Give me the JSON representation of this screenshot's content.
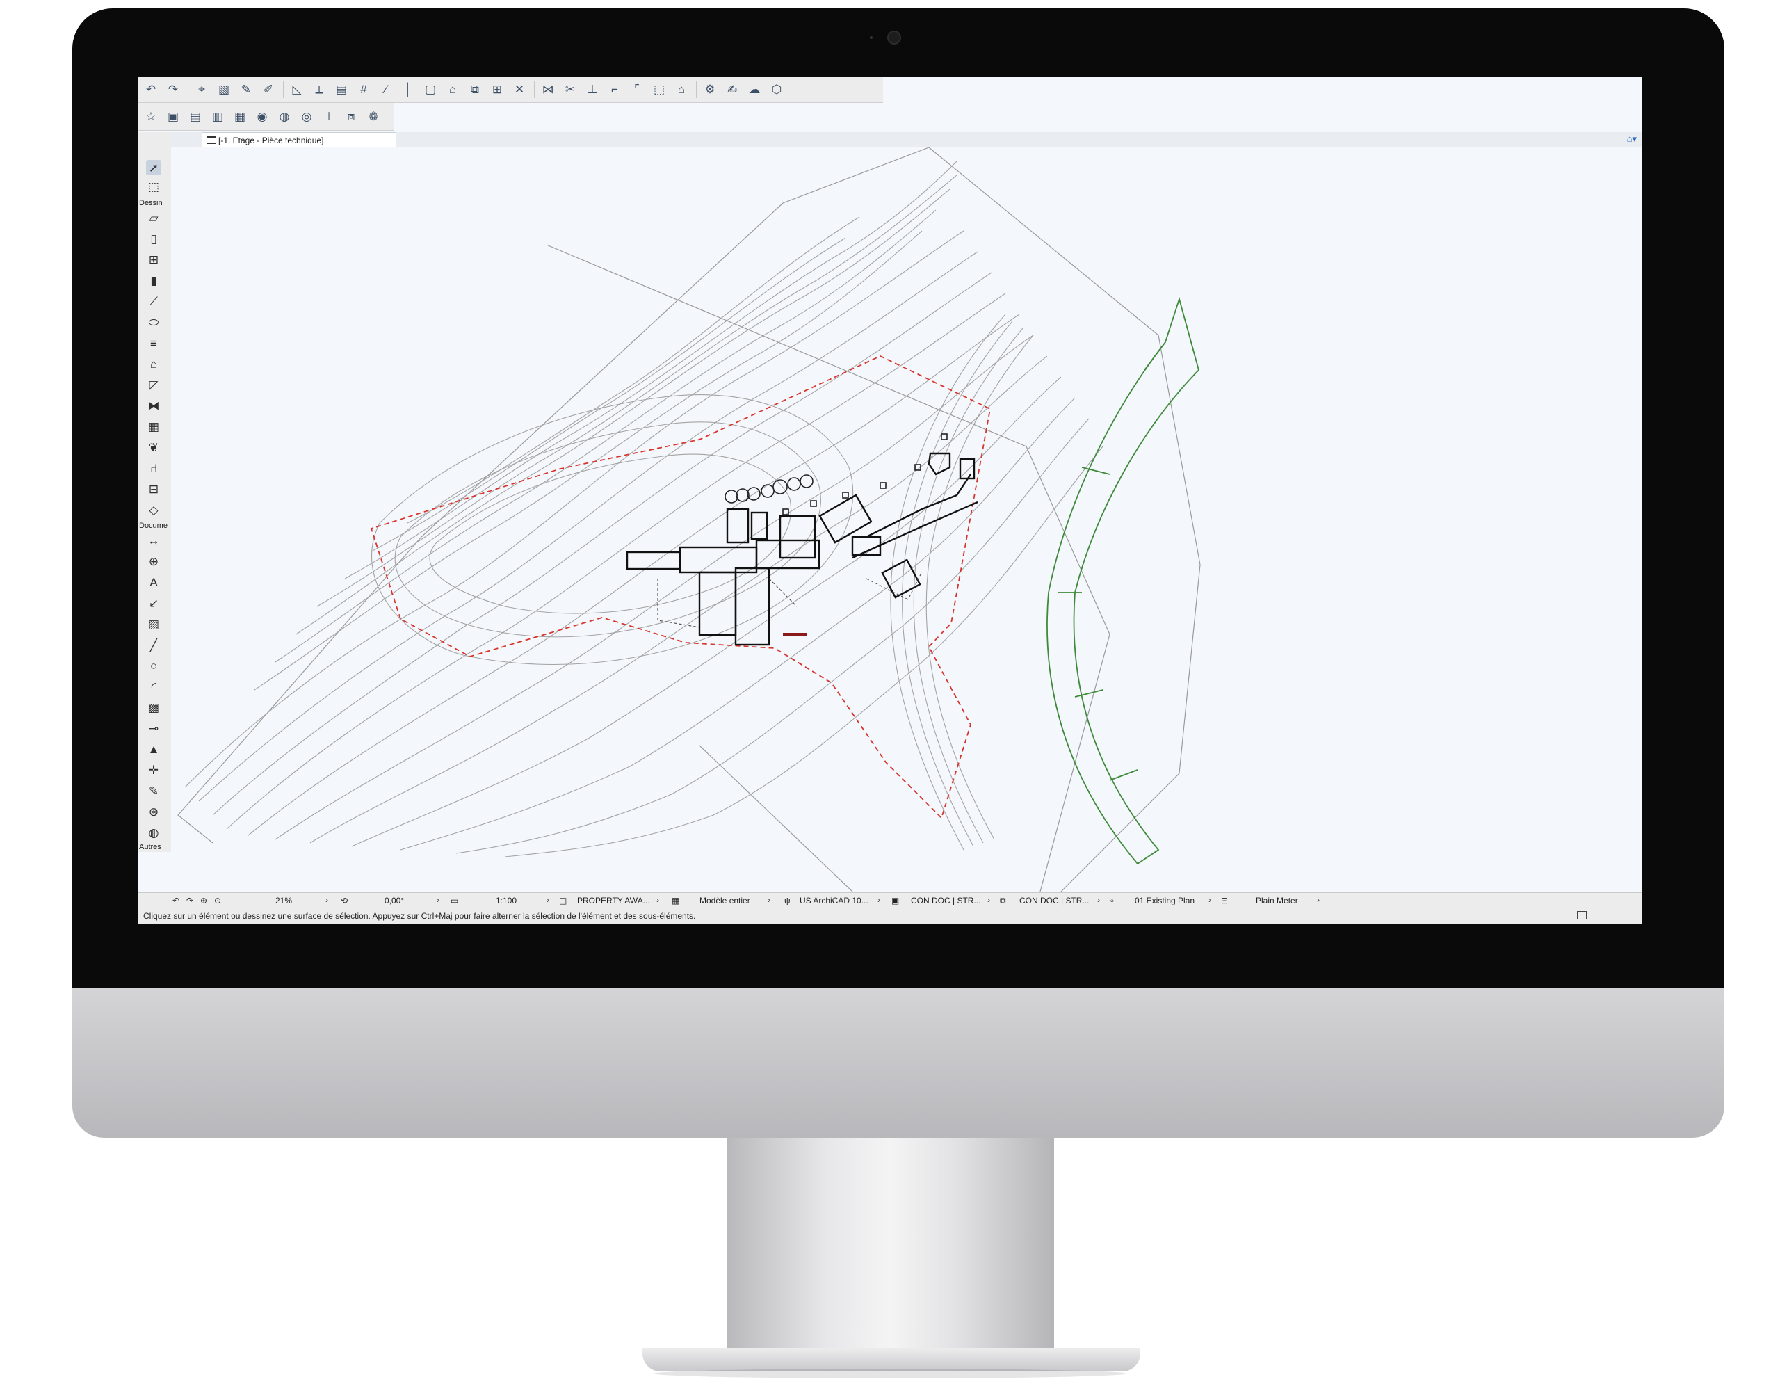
{
  "tab": {
    "label": "[-1. Etage - Pièce technique]"
  },
  "toolbox": {
    "sections": {
      "design": "Dessin",
      "document": "Docume",
      "other": "Autres"
    }
  },
  "status": {
    "zoom": "21%",
    "angle": "0,00°",
    "scale": "1:100",
    "layer_combo": "PROPERTY AWA...",
    "model_view": "Modèle entier",
    "pen_set": "US ArchiCAD 10...",
    "dimension": "CON DOC | STR...",
    "renovation": "CON DOC | STR...",
    "plan_view": "01 Existing Plan",
    "units": "Plain Meter",
    "hint": "Cliquez sur un élément ou dessinez une surface de sélection. Appuyez sur Ctrl+Maj pour faire alterner la sélection de l'élément et des sous-éléments."
  },
  "colors": {
    "contour": "#9c9c9c",
    "property_line": "#d9342b",
    "road_edge": "#3f8a3a",
    "building": "#111111",
    "canvas_bg": "#f4f8fc"
  },
  "icons": [
    "undo-icon",
    "redo-icon",
    "arrow-icon",
    "marquee-icon",
    "wall-icon",
    "door-icon",
    "window-icon",
    "column-icon",
    "beam-icon",
    "slab-icon",
    "roof-icon",
    "mesh-icon",
    "stair-icon",
    "curtain-wall-icon",
    "zone-icon",
    "object-icon",
    "dimension-icon",
    "text-icon",
    "label-icon",
    "fill-icon",
    "line-icon",
    "circle-icon",
    "arc-icon",
    "section-icon",
    "elevation-icon",
    "grid-icon",
    "hotspot-icon",
    "drawing-icon",
    "worksheet-icon",
    "camera-icon"
  ]
}
